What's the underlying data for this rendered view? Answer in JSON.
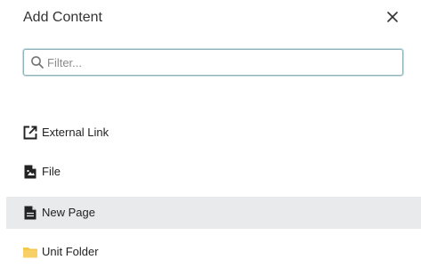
{
  "dialog": {
    "title": "Add Content",
    "close_icon": "close-icon"
  },
  "filter": {
    "placeholder": "Filter...",
    "value": "",
    "icon": "search-icon"
  },
  "items": [
    {
      "label": "External Link",
      "icon": "external-link-icon",
      "selected": false
    },
    {
      "label": "File",
      "icon": "file-icon",
      "selected": false
    },
    {
      "label": "New Page",
      "icon": "page-icon",
      "selected": true
    },
    {
      "label": "Unit Folder",
      "icon": "folder-icon",
      "selected": false
    }
  ],
  "colors": {
    "selected_row": "#e8eaec",
    "input_border": "#8fb3b9",
    "folder": "#f5c84c",
    "icon": "#222222"
  }
}
